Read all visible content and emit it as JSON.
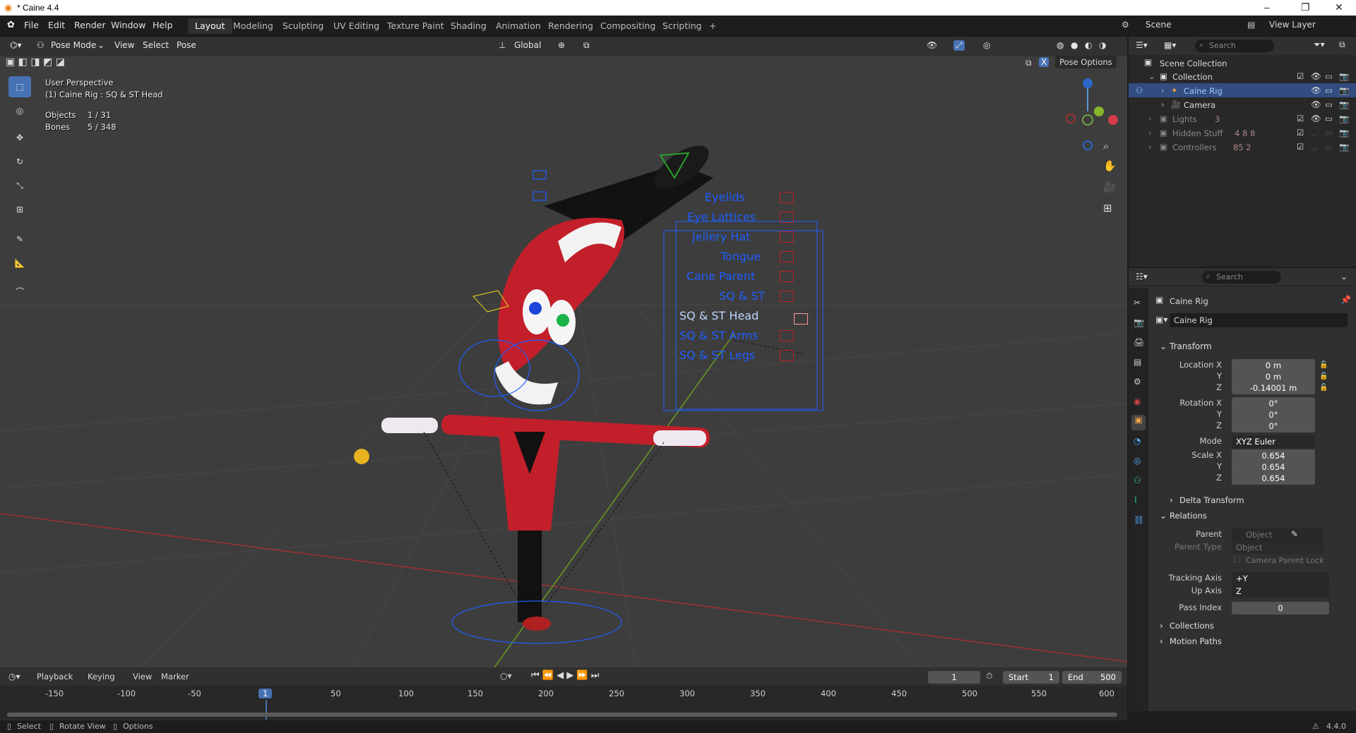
{
  "window": {
    "title": "* Caine 4.4",
    "minimize": "–",
    "maximize": "❐",
    "close": "✕"
  },
  "menu": [
    "File",
    "Edit",
    "Render",
    "Window",
    "Help"
  ],
  "workspaces": [
    "Layout",
    "Modeling",
    "Sculpting",
    "UV Editing",
    "Texture Paint",
    "Shading",
    "Animation",
    "Rendering",
    "Compositing",
    "Scripting",
    "+"
  ],
  "top_right": {
    "scene": "Scene",
    "view_layer": "View Layer"
  },
  "viewport_header": {
    "mode": "Pose Mode",
    "view": "View",
    "select": "Select",
    "pose": "Pose",
    "orientation": "Global",
    "pose_options": "Pose Options"
  },
  "overlay": {
    "line1": "User Perspective",
    "line2": "(1) Caine Rig : SQ & ST Head",
    "objects_label": "Objects",
    "objects_value": "1 / 31",
    "bones_label": "Bones",
    "bones_value": "5 / 348"
  },
  "controller_panel": [
    "Eyelids",
    "Eye Lattices",
    "Jellery Hat",
    "Tongue",
    "Cane Parent",
    "SQ & ST",
    "SQ & ST Head",
    "SQ & ST Arms",
    "SQ & ST Legs"
  ],
  "outliner": {
    "search_placeholder": "Search",
    "root": "Scene Collection",
    "rows": [
      {
        "label": "Collection"
      },
      {
        "label": "Caine Rig"
      },
      {
        "label": "Camera"
      },
      {
        "label": "Lights",
        "badge": "3"
      },
      {
        "label": "Hidden Stuff",
        "badge": "4  8  8"
      },
      {
        "label": "Controllers",
        "badge": "85  2"
      }
    ]
  },
  "properties": {
    "search_placeholder": "Search",
    "object_name": "Caine Rig",
    "datablock": "Caine Rig",
    "transform": {
      "title": "Transform",
      "location_label": "Location X",
      "loc_x": "0 m",
      "loc_y": "0 m",
      "loc_z": "-0.14001 m",
      "rotation_label": "Rotation X",
      "rot_x": "0°",
      "rot_y": "0°",
      "rot_z": "0°",
      "mode_label": "Mode",
      "mode": "XYZ Euler",
      "scale_label": "Scale X",
      "scale_x": "0.654",
      "scale_y": "0.654",
      "scale_z": "0.654",
      "y": "Y",
      "z": "Z"
    },
    "delta_transform": "Delta Transform",
    "relations": {
      "title": "Relations",
      "parent_label": "Parent",
      "parent_placeholder": "Object",
      "parent_type_label": "Parent Type",
      "parent_type": "Object",
      "camera_parent_lock": "Camera Parent Lock",
      "tracking_axis_label": "Tracking Axis",
      "tracking_axis": "+Y",
      "up_axis_label": "Up Axis",
      "up_axis": "Z",
      "pass_index_label": "Pass Index",
      "pass_index": "0"
    },
    "collections": "Collections",
    "motion_paths": "Motion Paths"
  },
  "timeline": {
    "playback": "Playback",
    "keying": "Keying",
    "view": "View",
    "marker": "Marker",
    "current_frame": "1",
    "start_label": "Start",
    "start": "1",
    "end_label": "End",
    "end": "500",
    "ticks": [
      "-150",
      "-100",
      "-50",
      "1",
      "50",
      "100",
      "150",
      "200",
      "250",
      "300",
      "350",
      "400",
      "450",
      "500",
      "550",
      "600"
    ]
  },
  "statusbar": {
    "select": "Select",
    "rotate": "Rotate View",
    "options": "Options",
    "version": "4.4.0"
  }
}
